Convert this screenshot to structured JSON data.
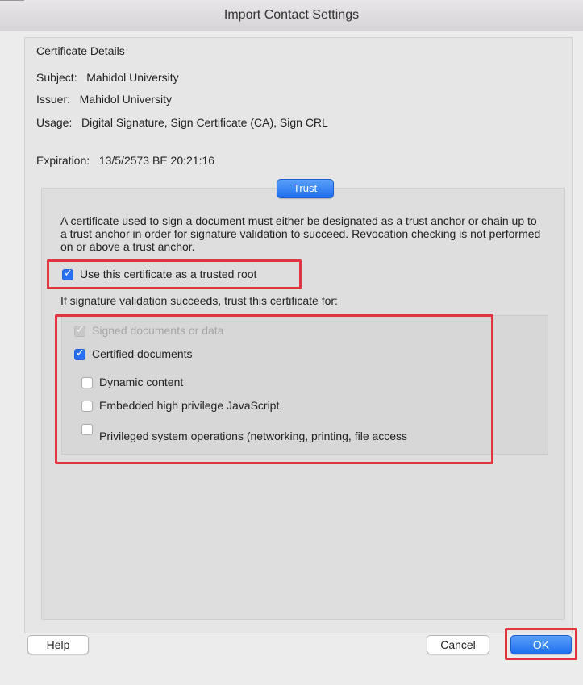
{
  "window": {
    "title": "Import Contact Settings"
  },
  "details": {
    "section_label": "Certificate Details",
    "subject": "Subject:   Mahidol University",
    "issuer": "Issuer:   Mahidol University",
    "usage": "Usage:   Digital Signature, Sign Certificate (CA), Sign CRL",
    "expiration": "Expiration:   13/5/2573 BE 20:21:16"
  },
  "trust": {
    "tab_label": "Trust",
    "description": "A certificate used to sign a document must either be designated as a trust anchor or chain up to a trust anchor in order for signature validation to succeed.  Revocation checking is not performed on or above a trust anchor.",
    "trusted_root": {
      "label": "Use this certificate as a trusted root",
      "checked": true
    },
    "trust_for_label": "If signature validation succeeds, trust this certificate for:",
    "options": [
      {
        "label": "Signed documents or data",
        "checked": true,
        "enabled": false
      },
      {
        "label": "Certified documents",
        "checked": true,
        "enabled": true
      },
      {
        "label": "Dynamic content",
        "checked": false,
        "enabled": true
      },
      {
        "label": "Embedded high privilege JavaScript",
        "checked": false,
        "enabled": true
      },
      {
        "label": "Privileged system operations (networking, printing, file access",
        "checked": false,
        "enabled": true
      }
    ]
  },
  "buttons": {
    "help": "Help",
    "cancel": "Cancel",
    "ok": "OK"
  },
  "colors": {
    "accent": "#2a6fef",
    "highlight": "#e0353e"
  }
}
